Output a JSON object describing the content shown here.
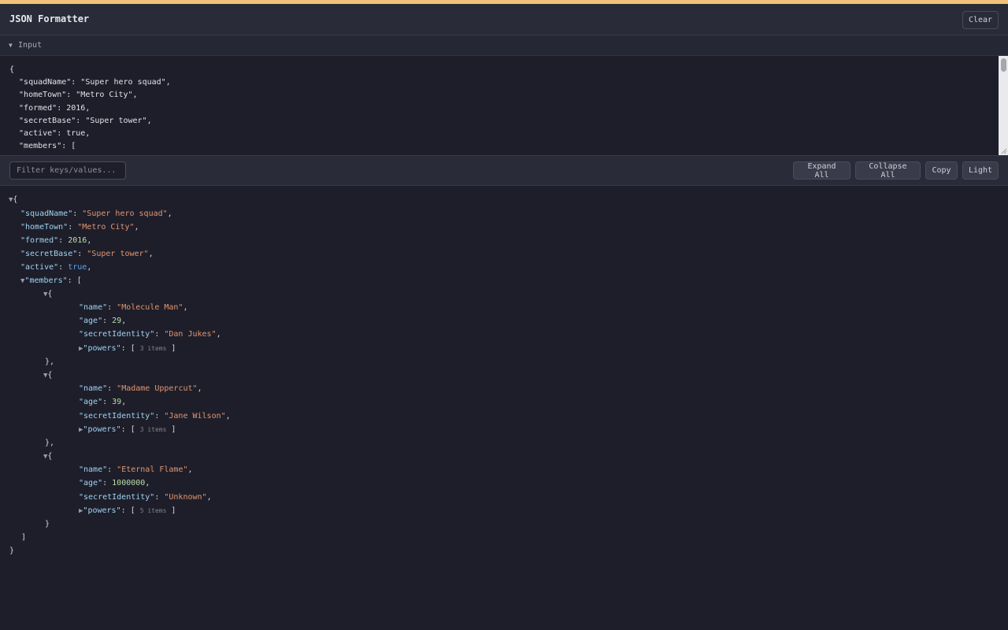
{
  "app": {
    "title": "JSON Formatter",
    "clear_label": "Clear"
  },
  "input_section": {
    "caret": "▼",
    "label": "Input"
  },
  "input_text": "{\n  \"squadName\": \"Super hero squad\",\n  \"homeTown\": \"Metro City\",\n  \"formed\": 2016,\n  \"secretBase\": \"Super tower\",\n  \"active\": true,\n  \"members\": [",
  "toolbar": {
    "filter_placeholder": "Filter keys/values...",
    "expand_all": "Expand All",
    "collapse_all": "Collapse All",
    "copy": "Copy",
    "theme": "Light"
  },
  "tree": {
    "root_open": "{",
    "root_close": "}",
    "fields": [
      {
        "key": "\"squadName\"",
        "value": "\"Super hero squad\"",
        "type": "string"
      },
      {
        "key": "\"homeTown\"",
        "value": "\"Metro City\"",
        "type": "string"
      },
      {
        "key": "\"formed\"",
        "value": "2016",
        "type": "number"
      },
      {
        "key": "\"secretBase\"",
        "value": "\"Super tower\"",
        "type": "string"
      },
      {
        "key": "\"active\"",
        "value": "true",
        "type": "boolean"
      }
    ],
    "members_key": "\"members\"",
    "members": [
      {
        "name": "\"Molecule Man\"",
        "age": "29",
        "secretIdentity": "\"Dan Jukes\"",
        "powers_summary": "3 items"
      },
      {
        "name": "\"Madame Uppercut\"",
        "age": "39",
        "secretIdentity": "\"Jane Wilson\"",
        "powers_summary": "3 items"
      },
      {
        "name": "\"Eternal Flame\"",
        "age": "1000000",
        "secretIdentity": "\"Unknown\"",
        "powers_summary": "5 items"
      }
    ],
    "member_keys": {
      "name": "\"name\"",
      "age": "\"age\"",
      "secretIdentity": "\"secretIdentity\"",
      "powers": "\"powers\""
    },
    "expanded_glyph": "▼",
    "collapsed_glyph": "▶"
  },
  "colors": {
    "accent_bar": "#f2c27a",
    "key": "#9fd4f2",
    "string": "#e09670",
    "number": "#b9dfa6",
    "boolean": "#5da2e8"
  }
}
